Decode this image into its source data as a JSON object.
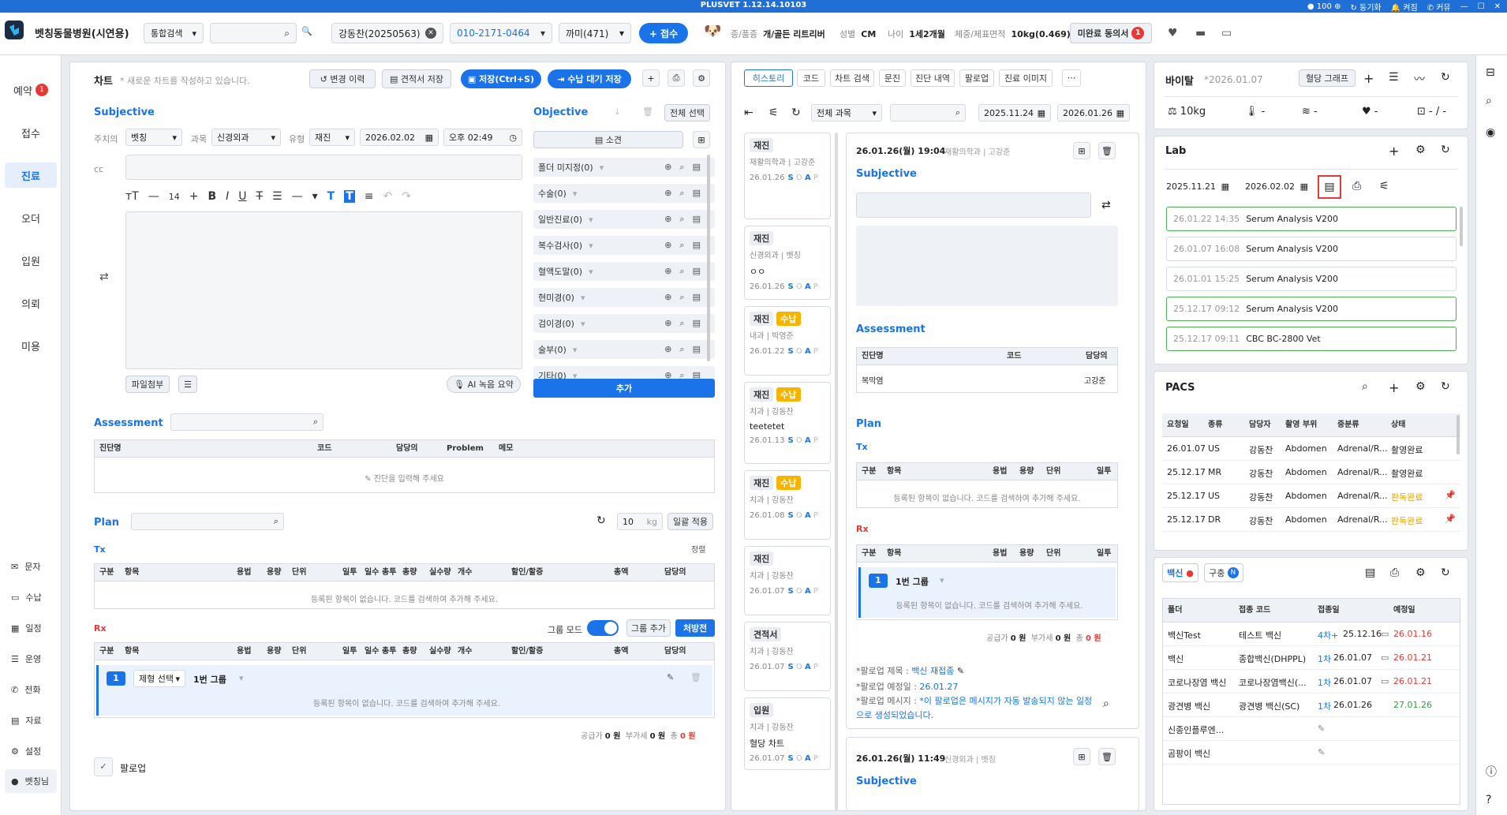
{
  "app": {
    "title": "PLUSVET 1.12.14.10103",
    "points": "100",
    "sync": "동기화",
    "power": "켜짐",
    "call": "커뮤"
  },
  "header": {
    "clinic": "벳칭동물병원(시연용)",
    "search_type": "통합검색",
    "patient_name": "강동찬(20250563)",
    "phone": "010-2171-0464",
    "pet": "까미(471)",
    "reception_btn": "+ 접수",
    "species_label": "종/품종",
    "species": "개/골든 리트리버",
    "sex_label": "성별",
    "sex": "CM",
    "age_label": "나이",
    "age": "1세2개월",
    "weight_label": "체중/체표면적",
    "weight": "10kg(0.469)",
    "unsigned_label": "미완료 동의서",
    "unsigned_count": "1"
  },
  "nav": {
    "items": [
      {
        "label": "예약",
        "badge": "1"
      },
      {
        "label": "접수"
      },
      {
        "label": "진료"
      },
      {
        "label": "오더"
      },
      {
        "label": "입원"
      },
      {
        "label": "의뢰"
      },
      {
        "label": "미용"
      }
    ],
    "sub": [
      "문자",
      "수납",
      "일정",
      "운영",
      "전화",
      "자료",
      "설정",
      "벳칭님"
    ]
  },
  "chart": {
    "title": "차트",
    "notice": "* 새로운 차트를 작성하고 있습니다.",
    "history_btn": "변경 이력",
    "estimate_btn": "견적서 저장",
    "save_btn": "저장(Ctrl+S)",
    "pay_btn": "수납 대기 저장",
    "subjective": "Subjective",
    "doctor_label": "주치의",
    "doctor": "벳칭",
    "dept_label": "과목",
    "dept": "신경외과",
    "type_label": "유형",
    "type": "재진",
    "date": "2026.02.02",
    "time": "오후 02:49",
    "cc": "cc",
    "font_size": "14",
    "attach_btn": "파일첨부",
    "ai_btn": "AI 녹음 요약",
    "objective": "Objective",
    "select_all": "전체 선택",
    "findings_btn": "소견",
    "obj_rows": [
      "폴더 미지정(0)",
      "수술(0)",
      "일반진료(0)",
      "복수검사(0)",
      "혈액도말(0)",
      "현미경(0)",
      "검이경(0)",
      "술부(0)",
      "기타(0)"
    ],
    "add_btn": "추가",
    "assessment": "Assessment",
    "assess_cols": [
      "진단명",
      "코드",
      "담당의",
      "Problem",
      "메모"
    ],
    "assess_empty": "진단을 입력해 주세요",
    "plan": "Plan",
    "weight_val": "10",
    "weight_unit": "kg",
    "apply_btn": "일괄 적용",
    "tx_label": "Tx",
    "sort_label": "정렬",
    "plan_cols": [
      "구분",
      "항목",
      "용법",
      "용량",
      "단위",
      "일투",
      "일수",
      "총투",
      "총량",
      "실수량",
      "개수",
      "할인/할증",
      "총액",
      "담당의"
    ],
    "plan_empty": "등록된 항목이 없습니다. 코드를 검색하여 추가해 주세요.",
    "rx_label": "Rx",
    "group_mode": "그룹 모드",
    "group_add": "그룹 추가",
    "prescription": "처방전",
    "group_num": "1",
    "formula_select": "제형 선택",
    "group_name": "1번 그룹",
    "supply_label": "공급가",
    "supply": "0 원",
    "vat_label": "부가세",
    "vat": "0 원",
    "total_label": "총",
    "total": "0 원",
    "followup": "팔로업"
  },
  "history": {
    "tabs": [
      "히스토리",
      "코드",
      "차트 검색",
      "문진",
      "진단 내역",
      "팔로업",
      "진료 이미지"
    ],
    "filter": "전체 과목",
    "from": "2025.11.24",
    "to": "2026.01.26",
    "cards": [
      {
        "type": "재진",
        "paid": "",
        "dept": "재활의학과 | 고강준",
        "note": "",
        "date": "26.01.26",
        "soap": "S O A P"
      },
      {
        "type": "재진",
        "paid": "",
        "dept": "신경외과 | 벳칭",
        "note": "ㅇㅇ",
        "date": "26.01.26",
        "soap": "S O A P"
      },
      {
        "type": "재진",
        "paid": "수납",
        "dept": "내과 | 박영준",
        "note": "",
        "date": "26.01.22",
        "soap": "S O A P"
      },
      {
        "type": "재진",
        "paid": "수납",
        "dept": "치과 | 강동찬",
        "note": "teetetet",
        "date": "26.01.13",
        "soap": "S O A P"
      },
      {
        "type": "재진",
        "paid": "수납",
        "dept": "치과 | 강동찬",
        "note": "",
        "date": "26.01.08",
        "soap": "S O A P"
      },
      {
        "type": "재진",
        "paid": "",
        "dept": "치과 | 강동찬",
        "note": "",
        "date": "26.01.07",
        "soap": "S O A P"
      },
      {
        "type": "견적서",
        "paid": "",
        "dept": "치과 | 강동찬",
        "note": "",
        "date": "26.01.07",
        "soap": "S O A P"
      },
      {
        "type": "입원",
        "paid": "",
        "dept": "치과 | 강동찬",
        "note": "혈당 차트",
        "date": "26.01.07",
        "soap": "S O A P"
      }
    ],
    "detail": {
      "datetime": "26.01.26(월) 19:04",
      "dept": "재활의학과 | 고강준",
      "subjective": "Subjective",
      "assessment": "Assessment",
      "assess_cols": [
        "진단명",
        "코드",
        "담당의"
      ],
      "diag": "복막염",
      "diag_doctor": "고강준",
      "plan": "Plan",
      "tx": "Tx",
      "tx_cols": [
        "구분",
        "항목",
        "용법",
        "용량",
        "단위",
        "일투"
      ],
      "empty": "등록된 항목이 없습니다. 코드를 검색하여 추가해 주세요.",
      "rx": "Rx",
      "group_num": "1",
      "group_name": "1번 그룹",
      "supply_label": "공급가",
      "supply": "0 원",
      "vat_label": "부가세",
      "vat": "0 원",
      "total_label": "총",
      "total": "0 원",
      "fu_title_label": "*팔로업 제목 :",
      "fu_title": "백신 재접종",
      "fu_date_label": "*팔로업 예정일 :",
      "fu_date": "26.01.27",
      "fu_msg_label": "*팔로업 메시지 :",
      "fu_msg": "*이 팔로업은 메시지가 자동 발송되지 않는 일정으로 생성되었습니다.",
      "datetime2": "26.01.26(월) 11:49",
      "dept2": "신경외과 | 벳칭",
      "subjective2": "Subjective"
    }
  },
  "vital": {
    "title": "바이탈",
    "date": "*2026.01.07",
    "graph_btn": "혈당 그래프",
    "weight": "10kg",
    "temp": "-",
    "resp": "-",
    "heart": "-",
    "bp": "- / -"
  },
  "lab": {
    "title": "Lab",
    "from": "2025.11.21",
    "to": "2026.02.02",
    "items": [
      {
        "time": "26.01.22 14:35",
        "name": "Serum Analysis  V200",
        "done": true
      },
      {
        "time": "26.01.07 16:08",
        "name": "Serum Analysis  V200",
        "done": false
      },
      {
        "time": "26.01.01 15:25",
        "name": "Serum Analysis  V200",
        "done": false
      },
      {
        "time": "25.12.17 09:12",
        "name": "Serum Analysis  V200",
        "done": true
      },
      {
        "time": "25.12.17 09:11",
        "name": "CBC  BC-2800 Vet",
        "done": true
      }
    ]
  },
  "pacs": {
    "title": "PACS",
    "cols": [
      "요청일",
      "종류",
      "담당자",
      "촬영 부위",
      "중분류",
      "상태"
    ],
    "rows": [
      {
        "date": "26.01.07",
        "kind": "US",
        "who": "강동찬",
        "part": "Abdomen",
        "sub": "Adrenal/R...",
        "status": "촬영완료",
        "read": false
      },
      {
        "date": "25.12.17",
        "kind": "MR",
        "who": "강동찬",
        "part": "Abdomen",
        "sub": "Adrenal/R...",
        "status": "촬영완료",
        "read": false
      },
      {
        "date": "25.12.17",
        "kind": "US",
        "who": "강동찬",
        "part": "Abdomen",
        "sub": "Adrenal/R...",
        "status": "판독완료",
        "read": true
      },
      {
        "date": "25.12.17",
        "kind": "DR",
        "who": "강동찬",
        "part": "Abdomen",
        "sub": "Adrenal/R...",
        "status": "판독완료",
        "read": true
      }
    ]
  },
  "vaccine": {
    "tab1": "백신",
    "tab2": "구충",
    "cols": [
      "폴더",
      "접종 코드",
      "접종일",
      "예정일"
    ],
    "rows": [
      {
        "folder": "백신Test",
        "code": "테스트 백신",
        "round": "4차+",
        "date": "25.12.16",
        "due": "26.01.16",
        "due_color": "red"
      },
      {
        "folder": "백신",
        "code": "종합백신(DHPPL)",
        "round": "1차",
        "date": "26.01.07",
        "due": "26.01.21",
        "due_color": "red"
      },
      {
        "folder": "코로나장염 백신",
        "code": "코로나장염백신(...",
        "round": "1차",
        "date": "26.01.07",
        "due": "26.01.21",
        "due_color": "red"
      },
      {
        "folder": "광견병 백신",
        "code": "광견병 백신(SC)",
        "round": "1차",
        "date": "26.01.26",
        "due": "27.01.26",
        "due_color": "green"
      },
      {
        "folder": "신종인플루엔...",
        "code": "",
        "round": "",
        "date": "",
        "due": "",
        "due_color": ""
      },
      {
        "folder": "곰팡이 백신",
        "code": "",
        "round": "",
        "date": "",
        "due": "",
        "due_color": ""
      }
    ]
  },
  "colors": {
    "accent": "#1a73e8",
    "red": "#e53935",
    "gold": "#f6b400",
    "green": "#2e9e3e"
  },
  "icons": [
    "search-icon",
    "gear-icon",
    "print-icon",
    "refresh-icon",
    "plus-icon",
    "calendar-icon",
    "clock-icon",
    "trash-icon",
    "doc-icon",
    "heart-icon",
    "thermometer-icon",
    "lungs-icon",
    "bp-icon",
    "dog-avatar-icon"
  ]
}
